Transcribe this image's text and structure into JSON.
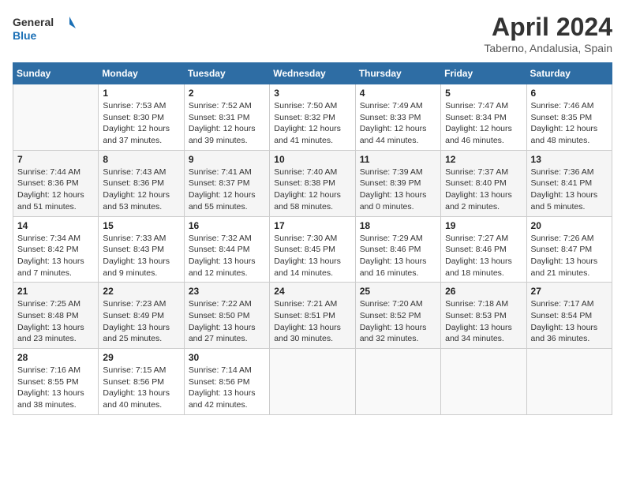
{
  "header": {
    "logo_line1": "General",
    "logo_line2": "Blue",
    "title": "April 2024",
    "subtitle": "Taberno, Andalusia, Spain"
  },
  "weekdays": [
    "Sunday",
    "Monday",
    "Tuesday",
    "Wednesday",
    "Thursday",
    "Friday",
    "Saturday"
  ],
  "weeks": [
    [
      {
        "day": "",
        "info": ""
      },
      {
        "day": "1",
        "info": "Sunrise: 7:53 AM\nSunset: 8:30 PM\nDaylight: 12 hours\nand 37 minutes."
      },
      {
        "day": "2",
        "info": "Sunrise: 7:52 AM\nSunset: 8:31 PM\nDaylight: 12 hours\nand 39 minutes."
      },
      {
        "day": "3",
        "info": "Sunrise: 7:50 AM\nSunset: 8:32 PM\nDaylight: 12 hours\nand 41 minutes."
      },
      {
        "day": "4",
        "info": "Sunrise: 7:49 AM\nSunset: 8:33 PM\nDaylight: 12 hours\nand 44 minutes."
      },
      {
        "day": "5",
        "info": "Sunrise: 7:47 AM\nSunset: 8:34 PM\nDaylight: 12 hours\nand 46 minutes."
      },
      {
        "day": "6",
        "info": "Sunrise: 7:46 AM\nSunset: 8:35 PM\nDaylight: 12 hours\nand 48 minutes."
      }
    ],
    [
      {
        "day": "7",
        "info": "Sunrise: 7:44 AM\nSunset: 8:36 PM\nDaylight: 12 hours\nand 51 minutes."
      },
      {
        "day": "8",
        "info": "Sunrise: 7:43 AM\nSunset: 8:36 PM\nDaylight: 12 hours\nand 53 minutes."
      },
      {
        "day": "9",
        "info": "Sunrise: 7:41 AM\nSunset: 8:37 PM\nDaylight: 12 hours\nand 55 minutes."
      },
      {
        "day": "10",
        "info": "Sunrise: 7:40 AM\nSunset: 8:38 PM\nDaylight: 12 hours\nand 58 minutes."
      },
      {
        "day": "11",
        "info": "Sunrise: 7:39 AM\nSunset: 8:39 PM\nDaylight: 13 hours\nand 0 minutes."
      },
      {
        "day": "12",
        "info": "Sunrise: 7:37 AM\nSunset: 8:40 PM\nDaylight: 13 hours\nand 2 minutes."
      },
      {
        "day": "13",
        "info": "Sunrise: 7:36 AM\nSunset: 8:41 PM\nDaylight: 13 hours\nand 5 minutes."
      }
    ],
    [
      {
        "day": "14",
        "info": "Sunrise: 7:34 AM\nSunset: 8:42 PM\nDaylight: 13 hours\nand 7 minutes."
      },
      {
        "day": "15",
        "info": "Sunrise: 7:33 AM\nSunset: 8:43 PM\nDaylight: 13 hours\nand 9 minutes."
      },
      {
        "day": "16",
        "info": "Sunrise: 7:32 AM\nSunset: 8:44 PM\nDaylight: 13 hours\nand 12 minutes."
      },
      {
        "day": "17",
        "info": "Sunrise: 7:30 AM\nSunset: 8:45 PM\nDaylight: 13 hours\nand 14 minutes."
      },
      {
        "day": "18",
        "info": "Sunrise: 7:29 AM\nSunset: 8:46 PM\nDaylight: 13 hours\nand 16 minutes."
      },
      {
        "day": "19",
        "info": "Sunrise: 7:27 AM\nSunset: 8:46 PM\nDaylight: 13 hours\nand 18 minutes."
      },
      {
        "day": "20",
        "info": "Sunrise: 7:26 AM\nSunset: 8:47 PM\nDaylight: 13 hours\nand 21 minutes."
      }
    ],
    [
      {
        "day": "21",
        "info": "Sunrise: 7:25 AM\nSunset: 8:48 PM\nDaylight: 13 hours\nand 23 minutes."
      },
      {
        "day": "22",
        "info": "Sunrise: 7:23 AM\nSunset: 8:49 PM\nDaylight: 13 hours\nand 25 minutes."
      },
      {
        "day": "23",
        "info": "Sunrise: 7:22 AM\nSunset: 8:50 PM\nDaylight: 13 hours\nand 27 minutes."
      },
      {
        "day": "24",
        "info": "Sunrise: 7:21 AM\nSunset: 8:51 PM\nDaylight: 13 hours\nand 30 minutes."
      },
      {
        "day": "25",
        "info": "Sunrise: 7:20 AM\nSunset: 8:52 PM\nDaylight: 13 hours\nand 32 minutes."
      },
      {
        "day": "26",
        "info": "Sunrise: 7:18 AM\nSunset: 8:53 PM\nDaylight: 13 hours\nand 34 minutes."
      },
      {
        "day": "27",
        "info": "Sunrise: 7:17 AM\nSunset: 8:54 PM\nDaylight: 13 hours\nand 36 minutes."
      }
    ],
    [
      {
        "day": "28",
        "info": "Sunrise: 7:16 AM\nSunset: 8:55 PM\nDaylight: 13 hours\nand 38 minutes."
      },
      {
        "day": "29",
        "info": "Sunrise: 7:15 AM\nSunset: 8:56 PM\nDaylight: 13 hours\nand 40 minutes."
      },
      {
        "day": "30",
        "info": "Sunrise: 7:14 AM\nSunset: 8:56 PM\nDaylight: 13 hours\nand 42 minutes."
      },
      {
        "day": "",
        "info": ""
      },
      {
        "day": "",
        "info": ""
      },
      {
        "day": "",
        "info": ""
      },
      {
        "day": "",
        "info": ""
      }
    ]
  ]
}
